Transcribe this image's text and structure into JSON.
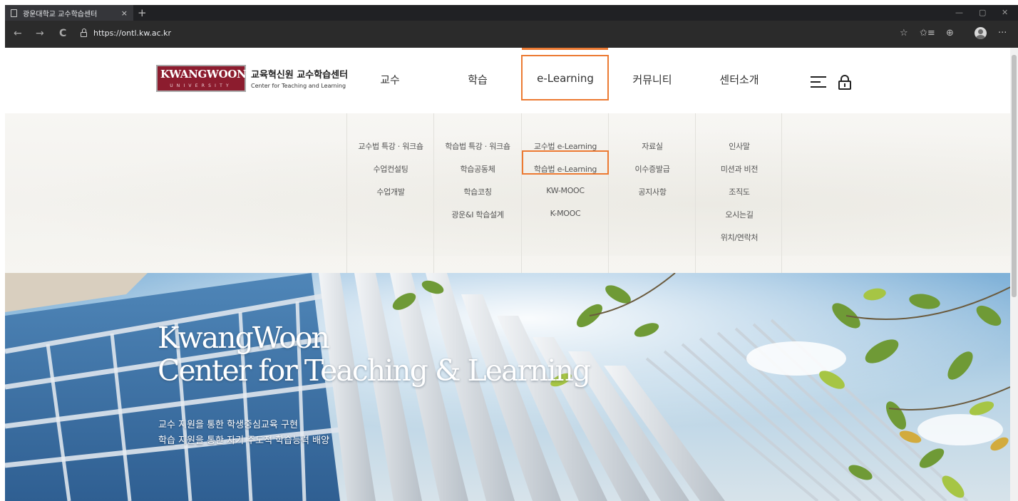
{
  "browser": {
    "tab_title": "광운대학교 교수학습센터",
    "tab_close": "×",
    "new_tab": "+",
    "url": "https://ontl.kw.ac.kr",
    "window_controls": {
      "minimize": "—",
      "restore": "▢",
      "close": "✕"
    },
    "nav": {
      "back": "←",
      "forward": "→",
      "reload": "C"
    },
    "toolbar": {
      "read_aloud": "☆",
      "favorites": "✩≡",
      "collections": "⊕",
      "more": "···"
    }
  },
  "brand": {
    "logo_main": "KWANGWOON",
    "logo_sub": "UNIVERSITY",
    "name_ko": "교육혁신원 교수학습센터",
    "name_en": "Center for Teaching and Learning"
  },
  "gnb": [
    {
      "label": "교수",
      "items": [
        "교수법 특강 · 워크숍",
        "수업컨설팅",
        "수업개발"
      ]
    },
    {
      "label": "학습",
      "items": [
        "학습법 특강 · 워크숍",
        "학습공동체",
        "학습코칭",
        "광운&I 학습설계"
      ]
    },
    {
      "label": "e-Learning",
      "items": [
        "교수법 e-Learning",
        "학습법 e-Learning",
        "KW-MOOC",
        "K-MOOC"
      ]
    },
    {
      "label": "커뮤니티",
      "items": [
        "자료실",
        "이수증발급",
        "공지사항"
      ]
    },
    {
      "label": "센터소개",
      "items": [
        "인사말",
        "미션과 비전",
        "조직도",
        "오시는길",
        "위치/연락처"
      ]
    }
  ],
  "colors": {
    "highlight": "#ec7a32",
    "brand": "#8c1c2e"
  },
  "hero": {
    "title_line1": "KwangWoon",
    "title_line2": "Center for Teaching & Learning",
    "sub_line1": "교수 지원을 통한 학생중심교육 구현",
    "sub_line2": "학습 지원을 통한 자기 주도적 학습능력 배양"
  }
}
